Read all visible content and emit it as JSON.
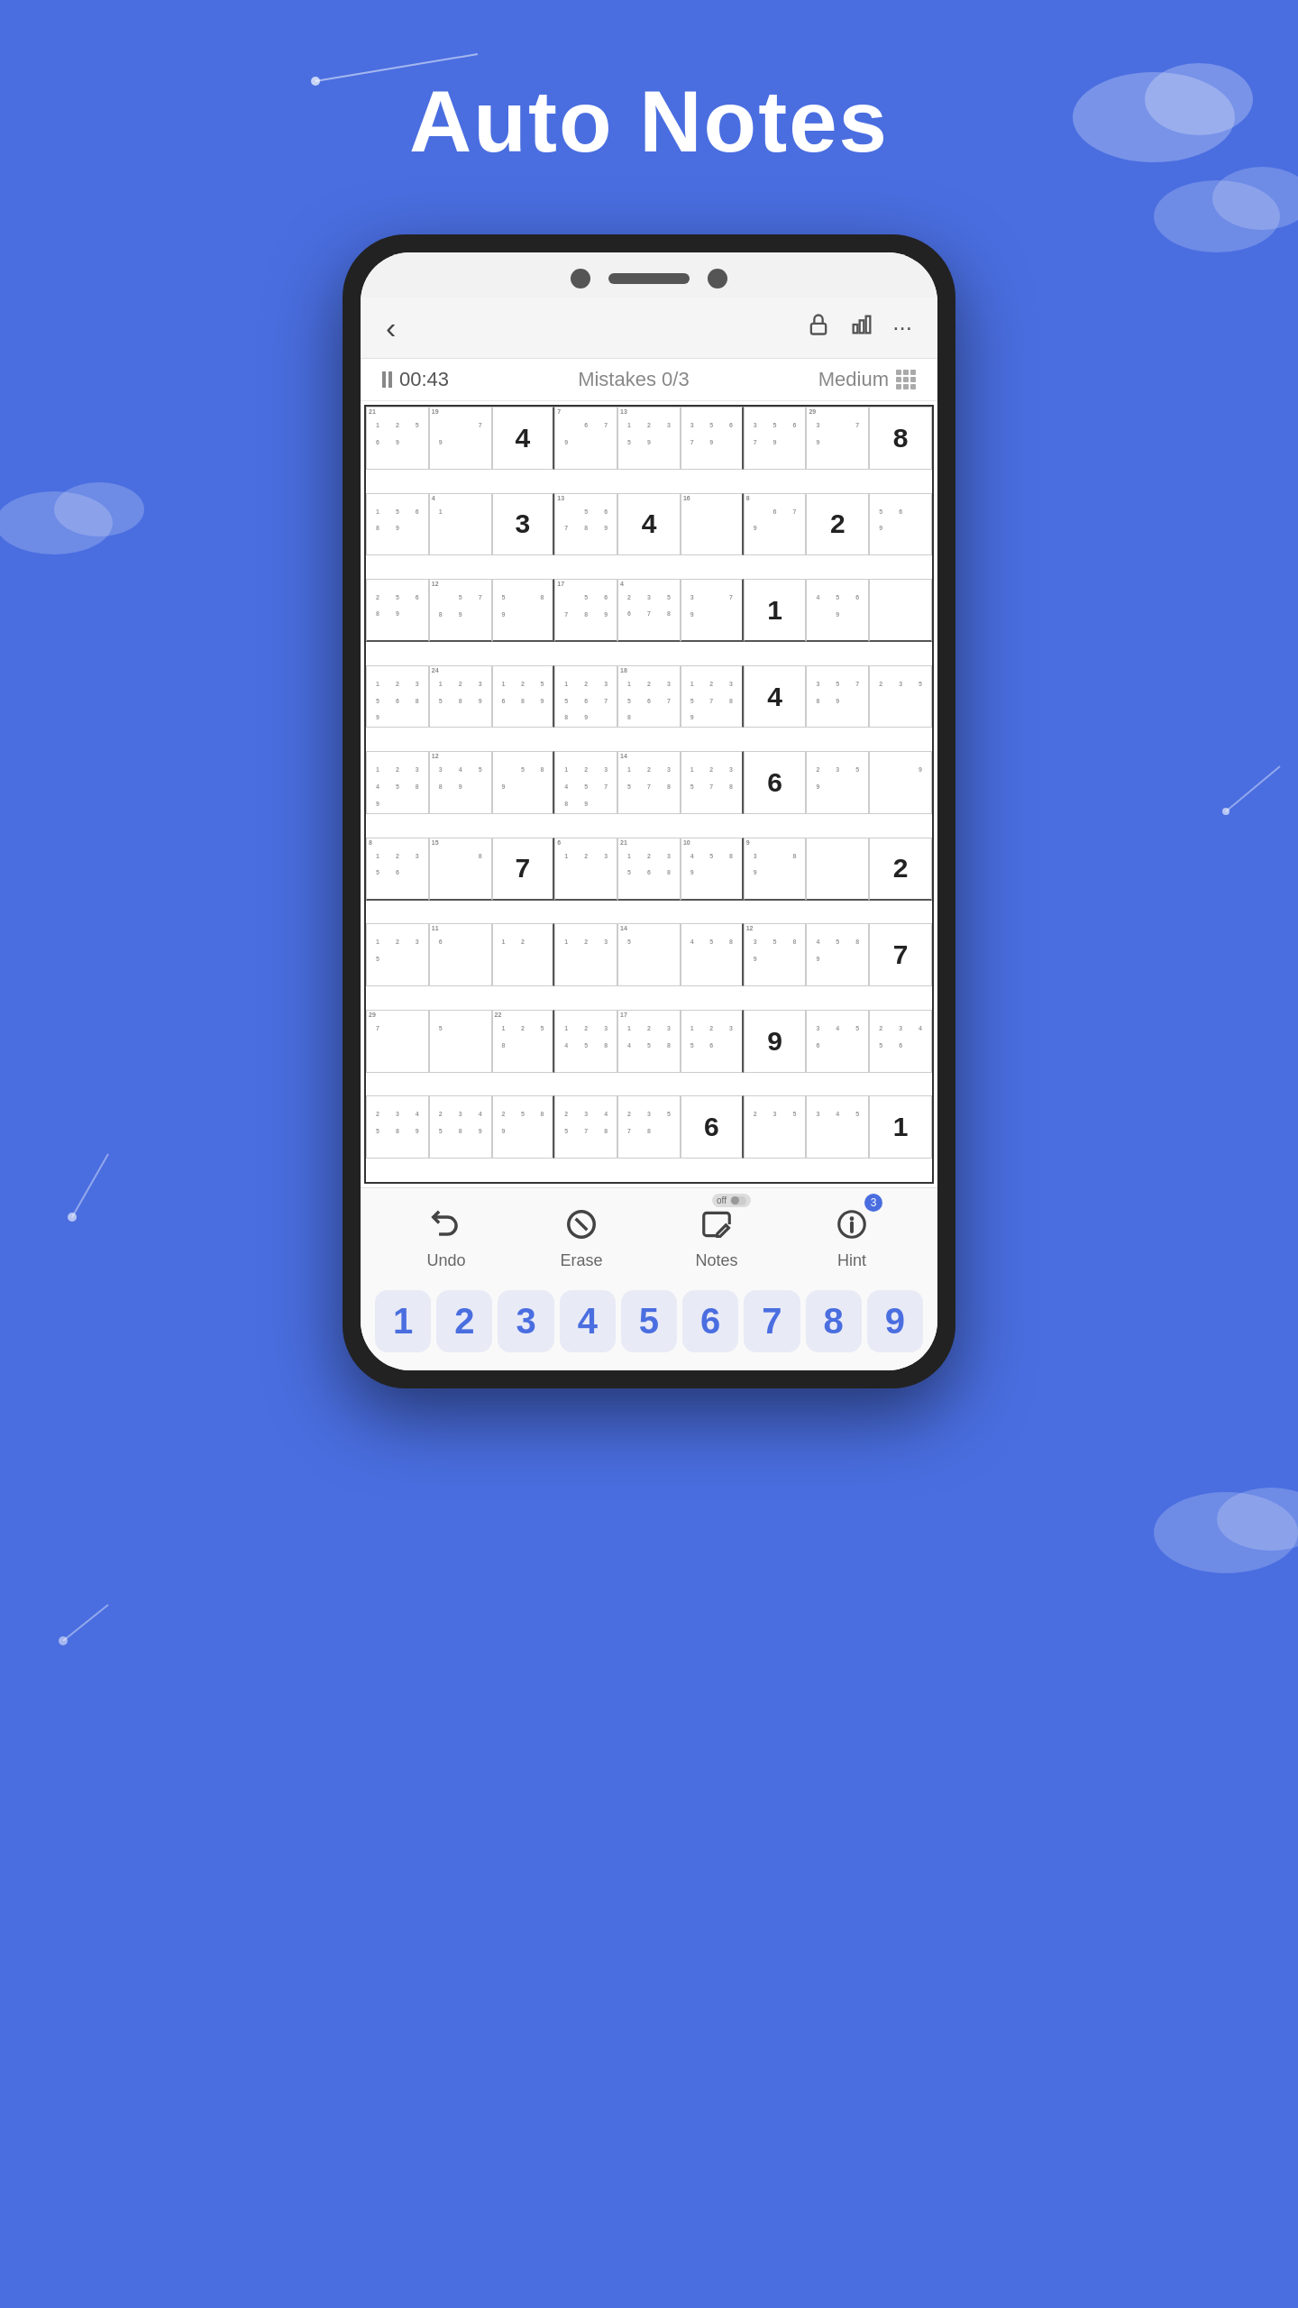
{
  "page": {
    "title": "Auto Notes",
    "background_color": "#4a6ee0"
  },
  "header": {
    "back_label": "‹",
    "icons": [
      "lock-icon",
      "chart-icon",
      "more-icon"
    ]
  },
  "game_info": {
    "timer": "00:43",
    "mistakes_label": "Mistakes 0/3",
    "difficulty": "Medium"
  },
  "toolbar": {
    "undo_label": "Undo",
    "erase_label": "Erase",
    "notes_label": "Notes",
    "notes_toggle": "off",
    "hint_label": "Hint",
    "hint_count": "3"
  },
  "numpad": {
    "buttons": [
      "1",
      "2",
      "3",
      "4",
      "5",
      "6",
      "7",
      "8",
      "9"
    ]
  },
  "sudoku": {
    "cells": [
      {
        "row": 0,
        "col": 0,
        "value": "",
        "corner_tl": "21",
        "notes": "1 2\n5 6\n  9"
      },
      {
        "row": 0,
        "col": 1,
        "value": "",
        "corner_tl": "19",
        "notes": "  \n  \n7  9"
      },
      {
        "row": 0,
        "col": 2,
        "value": "4",
        "given": true
      },
      {
        "row": 0,
        "col": 3,
        "value": "",
        "corner_tl": "7",
        "notes": "  \n6  \n7  9"
      },
      {
        "row": 0,
        "col": 4,
        "value": "",
        "corner_tl": "13",
        "notes": "1 2 3\n5  \n  9"
      },
      {
        "row": 0,
        "col": 5,
        "value": "",
        "notes": "3\n5 6\n7  9"
      },
      {
        "row": 0,
        "col": 6,
        "value": "",
        "notes": "3\n5 6\n7  9"
      },
      {
        "row": 0,
        "col": 7,
        "value": "",
        "corner_tl": "29",
        "notes": "3\n  \n7  9"
      },
      {
        "row": 0,
        "col": 8,
        "value": "8",
        "given": true
      },
      {
        "row": 1,
        "col": 0,
        "value": "",
        "notes": "1\n5 6\n8 9"
      },
      {
        "row": 1,
        "col": 1,
        "value": "",
        "corner_tl": "4",
        "notes": "1\n  \n  "
      },
      {
        "row": 1,
        "col": 2,
        "value": "3",
        "given": true
      },
      {
        "row": 1,
        "col": 3,
        "value": "",
        "corner_tl": "13",
        "notes": "  \n5 6\n7 8 9"
      },
      {
        "row": 1,
        "col": 4,
        "value": "4",
        "given": true
      },
      {
        "row": 1,
        "col": 5,
        "value": "",
        "corner_tl": "16",
        "notes": "  \n  \n  "
      },
      {
        "row": 1,
        "col": 6,
        "value": "",
        "corner_tl": "8",
        "notes": "  \n6\n7  9"
      },
      {
        "row": 1,
        "col": 7,
        "value": "2",
        "given": true
      },
      {
        "row": 1,
        "col": 8,
        "value": "",
        "notes": "5 6\n  \n  9"
      },
      {
        "row": 2,
        "col": 0,
        "value": "",
        "notes": "2\n5 6\n8 9"
      },
      {
        "row": 2,
        "col": 1,
        "value": "",
        "corner_tl": "12",
        "notes": "  \n5\n7 8 9"
      },
      {
        "row": 2,
        "col": 2,
        "value": "",
        "notes": "5\n  \n8 9"
      },
      {
        "row": 2,
        "col": 3,
        "value": "",
        "corner_tl": "17",
        "notes": "  \n5 6\n7 8 9"
      },
      {
        "row": 2,
        "col": 4,
        "value": "",
        "corner_tl": "4",
        "notes": "2 3\n5 6\n7 8"
      },
      {
        "row": 2,
        "col": 5,
        "value": "",
        "notes": "3\n  \n7  9"
      },
      {
        "row": 2,
        "col": 6,
        "value": "1",
        "given": true
      },
      {
        "row": 2,
        "col": 7,
        "value": "",
        "notes": "4 5 6\n  \n  9"
      },
      {
        "row": 2,
        "col": 8,
        "value": "",
        "notes": "  \n  \n  "
      },
      {
        "row": 3,
        "col": 0,
        "value": "",
        "notes": "1 2 3\n5 6\n8 9"
      },
      {
        "row": 3,
        "col": 1,
        "value": "",
        "corner_tl": "24",
        "notes": "1 2 3\n5\n8 9"
      },
      {
        "row": 3,
        "col": 2,
        "value": "",
        "notes": "1 2\n5 6\n8 9"
      },
      {
        "row": 3,
        "col": 3,
        "value": "",
        "notes": "1 2 3\n5 6\n7 8 9"
      },
      {
        "row": 3,
        "col": 4,
        "value": "",
        "corner_tl": "18",
        "notes": "1 2 3\n5 6\n7 8"
      },
      {
        "row": 3,
        "col": 5,
        "value": "",
        "notes": "1 2 3\n5\n7 8 9"
      },
      {
        "row": 3,
        "col": 6,
        "value": "4",
        "given": true
      },
      {
        "row": 3,
        "col": 7,
        "value": "",
        "notes": "3\n5\n7 8 9"
      },
      {
        "row": 3,
        "col": 8,
        "value": "",
        "notes": "2 3\n5\n  "
      },
      {
        "row": 4,
        "col": 0,
        "value": "",
        "notes": "1 2 3\n4 5\n8 9"
      },
      {
        "row": 4,
        "col": 1,
        "value": "",
        "corner_tl": "12",
        "notes": "3\n4 5\n8 9"
      },
      {
        "row": 4,
        "col": 2,
        "value": "",
        "notes": "  \n5\n8 9"
      },
      {
        "row": 4,
        "col": 3,
        "value": "",
        "notes": "1 2 3\n4 5\n7 8 9"
      },
      {
        "row": 4,
        "col": 4,
        "value": "",
        "corner_tl": "14",
        "notes": "1 2 3\n5\n7 8"
      },
      {
        "row": 4,
        "col": 5,
        "value": "",
        "notes": "1 2 3\n5\n7 8"
      },
      {
        "row": 4,
        "col": 6,
        "value": "6",
        "given": true
      },
      {
        "row": 4,
        "col": 7,
        "value": "",
        "notes": "2 3\n5\n  9"
      },
      {
        "row": 4,
        "col": 8,
        "value": "",
        "notes": "  \n  \n  9"
      },
      {
        "row": 5,
        "col": 0,
        "value": "",
        "corner_tl": "8",
        "notes": "1 2 3\n5 6\n  "
      },
      {
        "row": 5,
        "col": 1,
        "value": "",
        "corner_tl": "15",
        "notes": "  \n  \n8"
      },
      {
        "row": 5,
        "col": 2,
        "value": "7",
        "given": true
      },
      {
        "row": 5,
        "col": 3,
        "value": "",
        "corner_tl": "6",
        "notes": "1 2 3\n  \n  "
      },
      {
        "row": 5,
        "col": 4,
        "value": "",
        "corner_tl": "21",
        "notes": "1 2 3\n5 6\n  8"
      },
      {
        "row": 5,
        "col": 5,
        "value": "",
        "corner_tl": "10",
        "notes": "4 5\n8 9"
      },
      {
        "row": 5,
        "col": 6,
        "value": "",
        "corner_tl": "9",
        "notes": "3\n  \n8 9"
      },
      {
        "row": 5,
        "col": 7,
        "value": "",
        "notes": "  \n  \n  "
      },
      {
        "row": 5,
        "col": 8,
        "value": "2",
        "given": true
      },
      {
        "row": 6,
        "col": 0,
        "value": "",
        "notes": "1 2 3\n5\n  "
      },
      {
        "row": 6,
        "col": 1,
        "value": "",
        "corner_tl": "11",
        "notes": "6",
        "big": true
      },
      {
        "row": 6,
        "col": 2,
        "value": "",
        "notes": "1 2"
      },
      {
        "row": 6,
        "col": 3,
        "value": "",
        "notes": "1 2 3\n  "
      },
      {
        "row": 6,
        "col": 4,
        "value": "",
        "corner_tl": "14",
        "notes": "5"
      },
      {
        "row": 6,
        "col": 5,
        "value": "",
        "notes": "4 5\n8"
      },
      {
        "row": 6,
        "col": 6,
        "value": "",
        "corner_tl": "12",
        "notes": "3\n5 8 9"
      },
      {
        "row": 6,
        "col": 7,
        "value": "",
        "notes": "4 5\n8 9"
      },
      {
        "row": 6,
        "col": 8,
        "value": "7",
        "given": true
      },
      {
        "row": 7,
        "col": 0,
        "value": "",
        "corner_tl": "29",
        "notes": "7",
        "big": true
      },
      {
        "row": 7,
        "col": 1,
        "value": "",
        "notes": "5"
      },
      {
        "row": 7,
        "col": 2,
        "value": "",
        "corner_tl": "22",
        "notes": "1 2\n5\n8"
      },
      {
        "row": 7,
        "col": 3,
        "value": "",
        "notes": "1 2 3\n4 5\n8"
      },
      {
        "row": 7,
        "col": 4,
        "value": "",
        "corner_tl": "17",
        "notes": "1 2 3\n4 5\n8"
      },
      {
        "row": 7,
        "col": 5,
        "value": "",
        "notes": "1 2 3\n5 6\n  "
      },
      {
        "row": 7,
        "col": 6,
        "value": "9",
        "given": true
      },
      {
        "row": 7,
        "col": 7,
        "value": "",
        "notes": "3\n4 5 6"
      },
      {
        "row": 7,
        "col": 8,
        "value": "",
        "notes": "2 3\n4 5 6"
      },
      {
        "row": 8,
        "col": 0,
        "value": "",
        "notes": "2 3\n4 5\n8 9"
      },
      {
        "row": 8,
        "col": 1,
        "value": "",
        "notes": "2 3\n4 5\n8 9"
      },
      {
        "row": 8,
        "col": 2,
        "value": "",
        "notes": "2\n5\n8 9"
      },
      {
        "row": 8,
        "col": 3,
        "value": "",
        "notes": "2 3\n4 5\n7 8"
      },
      {
        "row": 8,
        "col": 4,
        "value": "",
        "notes": "2 3\n5\n7 8"
      },
      {
        "row": 8,
        "col": 5,
        "value": "6",
        "given": true
      },
      {
        "row": 8,
        "col": 6,
        "value": "",
        "notes": "2 3\n5"
      },
      {
        "row": 8,
        "col": 7,
        "value": "",
        "notes": "3\n4 5"
      },
      {
        "row": 8,
        "col": 8,
        "value": "1",
        "given": true
      }
    ]
  }
}
